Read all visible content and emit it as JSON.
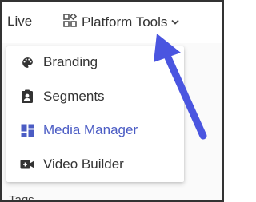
{
  "nav": {
    "live_label": "Live",
    "platform_tools_label": "Platform Tools"
  },
  "menu": {
    "items": [
      {
        "label": "Branding",
        "icon": "palette-icon"
      },
      {
        "label": "Segments",
        "icon": "clipboard-user-icon"
      },
      {
        "label": "Media Manager",
        "icon": "dashboard-grid-icon",
        "active": true
      },
      {
        "label": "Video Builder",
        "icon": "video-camera-icon"
      }
    ]
  },
  "below": {
    "label": "Tags"
  },
  "colors": {
    "accent": "#4b5cc4",
    "arrow": "#4a55e0",
    "text": "#333333"
  }
}
